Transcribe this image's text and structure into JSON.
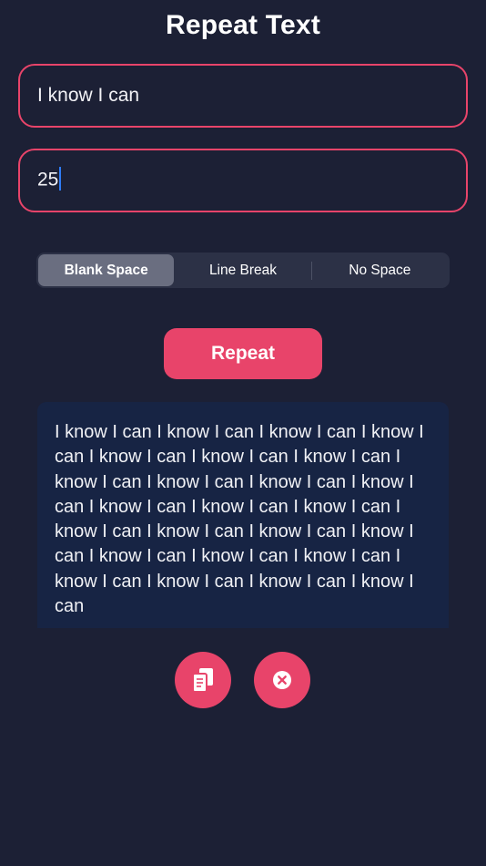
{
  "header": {
    "title": "Repeat Text"
  },
  "inputs": {
    "text_value": "I know I can",
    "count_value": "25"
  },
  "separator_options": {
    "items": [
      {
        "label": "Blank Space",
        "selected": true
      },
      {
        "label": "Line Break",
        "selected": false
      },
      {
        "label": "No Space",
        "selected": false
      }
    ]
  },
  "actions": {
    "repeat_label": "Repeat",
    "copy_icon": "copy-icon",
    "clear_icon": "clear-x-circle-icon"
  },
  "output": {
    "text": "I know I can I know I can I know I can I know I can I know I can I know I can I know I can I know I can I know I can I know I can I know I can I know I can I know I can I know I can I know I can I know I can I know I can I know I can I know I can I know I can I know I can I know I can I know I can I know I can I know I can"
  },
  "colors": {
    "background": "#1c2035",
    "accent": "#e8446a",
    "segment_bg": "#2c3146",
    "segment_selected": "#6a6e80",
    "output_bg": "#172444",
    "caret": "#2f7cf6"
  }
}
